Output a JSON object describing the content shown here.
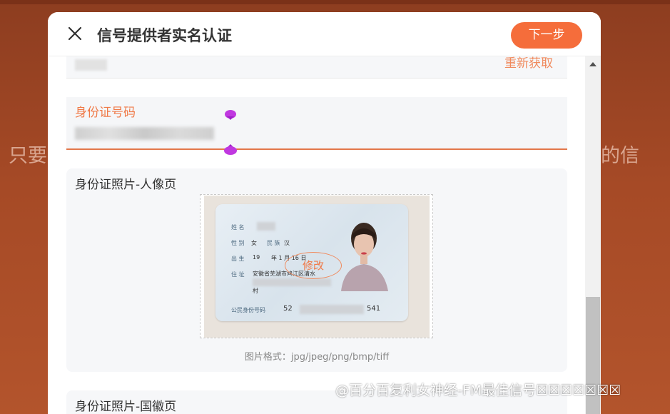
{
  "background": {
    "left_text": "只要",
    "right_text": "的信"
  },
  "modal": {
    "title": "信号提供者实名认证",
    "next_button": "下一步",
    "close_icon": "close-icon",
    "accent_color": "#f56d3b"
  },
  "code_row": {
    "refetch_label": "重新获取"
  },
  "id_field": {
    "label": "身份证号码"
  },
  "front_card": {
    "title": "身份证照片-人像页",
    "modify_label": "修改",
    "format_hint": "图片格式：jpg/jpeg/png/bmp/tiff",
    "idcard": {
      "name_label": "姓 名",
      "sex_label": "性 别",
      "sex_value": "女",
      "ethnic_label": "民 族",
      "ethnic_value": "汉",
      "birth_label": "出 生",
      "birth_year": "19",
      "birth_rest": "年 1 月 16 日",
      "address_label": "住 址",
      "address_value": "安徽省芜湖市鸠江区清水",
      "address_line2": "村",
      "id_label": "公民身份号码",
      "id_prefix": "52",
      "id_suffix": "541"
    }
  },
  "back_card": {
    "title": "身份证照片-国徽页"
  },
  "watermark": "@百分百复利女神经-FM最佳信号☒☒☒☒☒☒☒"
}
